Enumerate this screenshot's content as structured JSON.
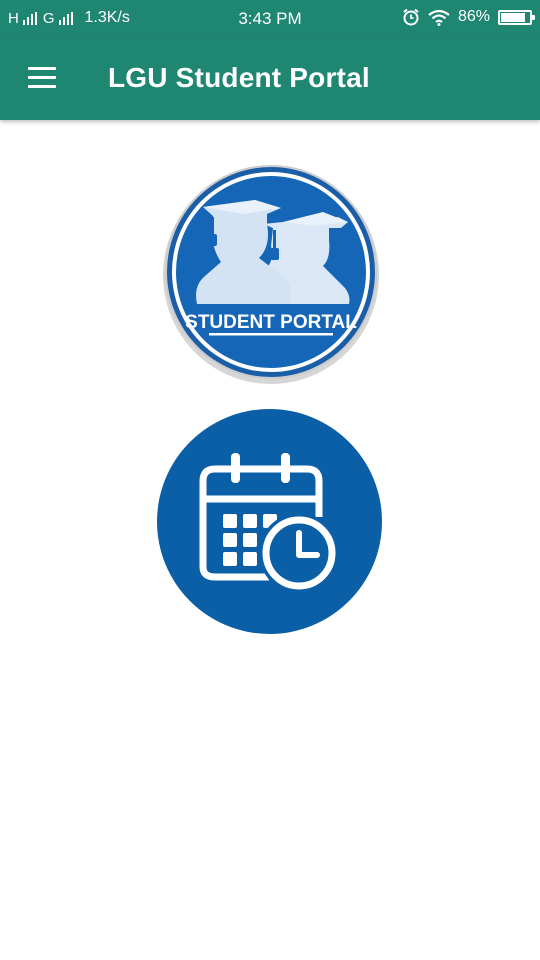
{
  "status_bar": {
    "signal_1": "H",
    "signal_2": "G",
    "net_speed": "1.3K/s",
    "time": "3:43 PM",
    "battery_percent": "86%",
    "battery_level": 0.86,
    "icons": [
      "signal-icon",
      "alarm-icon",
      "wifi-icon",
      "battery-icon"
    ]
  },
  "app_bar": {
    "title": "LGU Student Portal",
    "menu_icon": "menu-icon",
    "background_color": "#1f8672"
  },
  "main": {
    "student_portal": {
      "label": "STUDENT PORTAL",
      "icon": "graduates-icon",
      "color": "#1566b6"
    },
    "timetable": {
      "icon": "calendar-clock-icon",
      "color": "#0b5fa6"
    }
  }
}
